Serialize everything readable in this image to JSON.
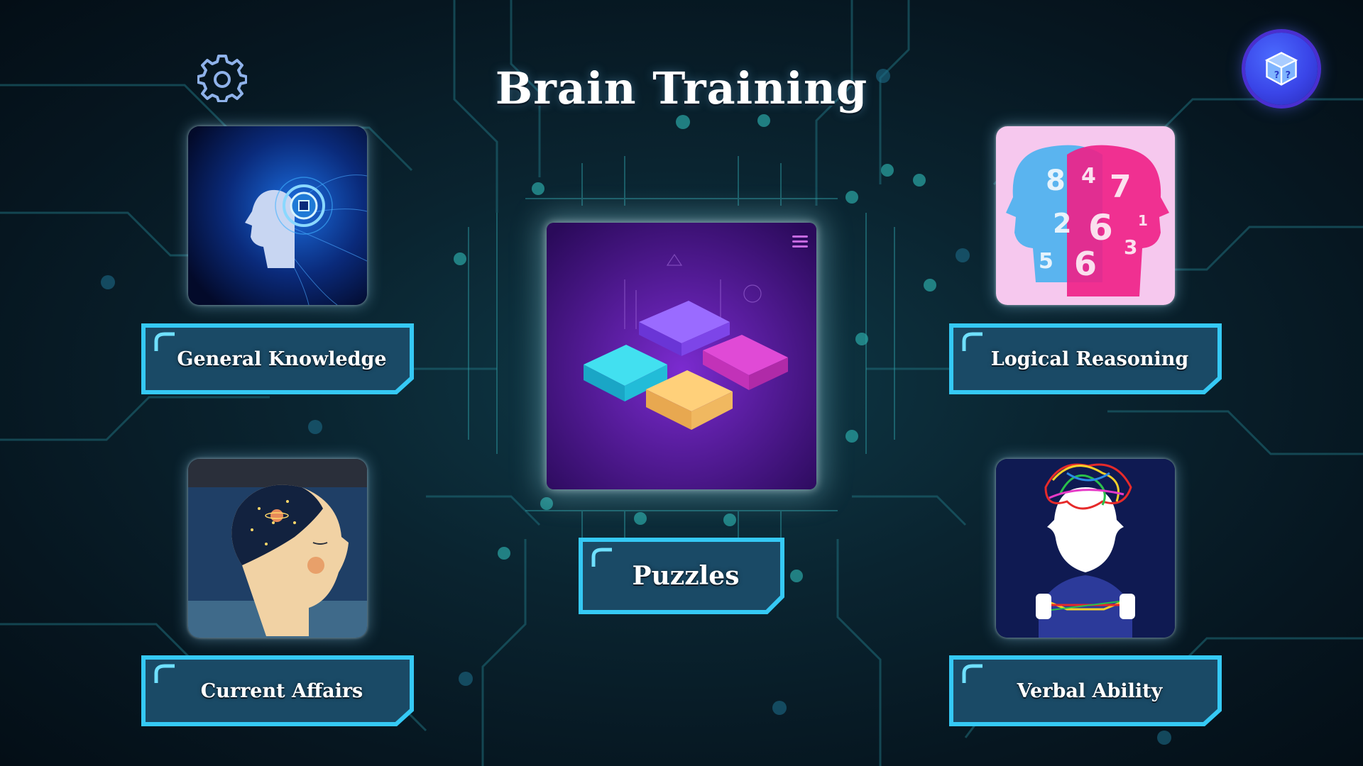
{
  "title": "Brain Training",
  "colors": {
    "background": "#0a2430",
    "label_border": "#35c9f5",
    "label_fill": "#1a4a66",
    "accent_button": "#3a45e8"
  },
  "settings_button": {
    "icon": "gear-icon"
  },
  "random_button": {
    "icon": "dice-icon"
  },
  "categories": [
    {
      "label": "General Knowledge",
      "image": "ai-head-image"
    },
    {
      "label": "Logical Reasoning",
      "image": "numbers-head-image"
    },
    {
      "label": "Puzzles",
      "image": "puzzle-pieces-image"
    },
    {
      "label": "Current Affairs",
      "image": "space-mind-image"
    },
    {
      "label": "Verbal Ability",
      "image": "tangled-thoughts-image"
    }
  ]
}
